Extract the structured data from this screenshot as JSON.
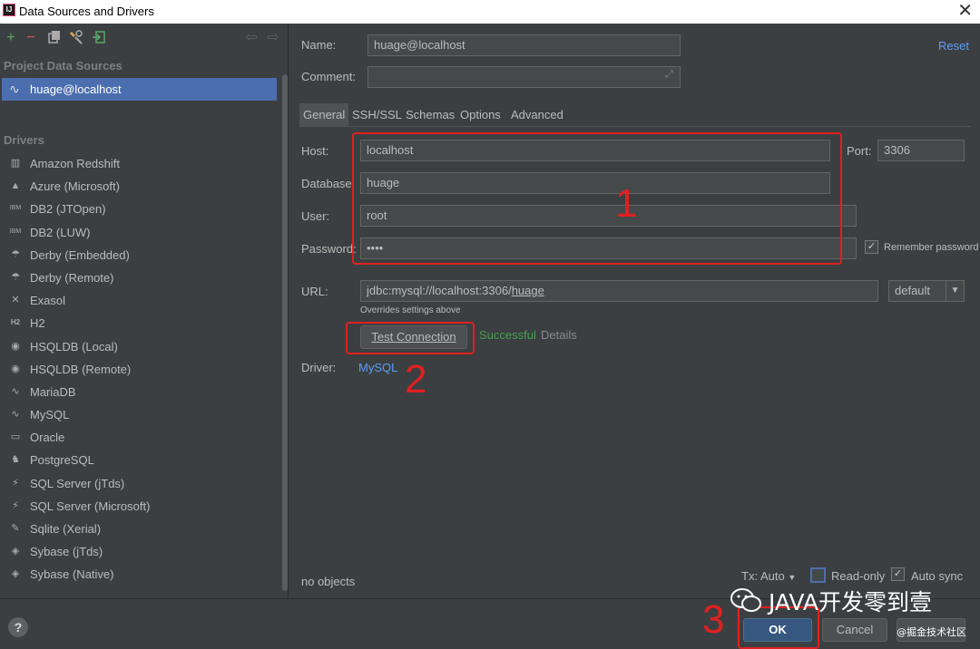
{
  "window": {
    "title": "Data Sources and Drivers",
    "app_icon": "IJ",
    "close_glyph": "✕"
  },
  "left": {
    "toolbar_icons": [
      "add-icon",
      "remove-icon",
      "copy-icon",
      "settings-icon",
      "import-icon",
      "back-icon",
      "forward-icon"
    ],
    "project_title": "Project Data Sources",
    "data_source": "huage@localhost",
    "drivers_title": "Drivers",
    "drivers": [
      {
        "label": "Amazon Redshift",
        "icon": "▥"
      },
      {
        "label": "Azure (Microsoft)",
        "icon": "▲"
      },
      {
        "label": "DB2 (JTOpen)",
        "icon": "IBM"
      },
      {
        "label": "DB2 (LUW)",
        "icon": "IBM"
      },
      {
        "label": "Derby (Embedded)",
        "icon": "☂"
      },
      {
        "label": "Derby (Remote)",
        "icon": "☂"
      },
      {
        "label": "Exasol",
        "icon": "✕"
      },
      {
        "label": "H2",
        "icon": "H2"
      },
      {
        "label": "HSQLDB (Local)",
        "icon": "◉"
      },
      {
        "label": "HSQLDB (Remote)",
        "icon": "◉"
      },
      {
        "label": "MariaDB",
        "icon": "∿"
      },
      {
        "label": "MySQL",
        "icon": "∿"
      },
      {
        "label": "Oracle",
        "icon": "▭"
      },
      {
        "label": "PostgreSQL",
        "icon": "♞"
      },
      {
        "label": "SQL Server (jTds)",
        "icon": "⚡"
      },
      {
        "label": "SQL Server (Microsoft)",
        "icon": "⚡"
      },
      {
        "label": "Sqlite (Xerial)",
        "icon": "✎"
      },
      {
        "label": "Sybase (jTds)",
        "icon": "◈"
      },
      {
        "label": "Sybase (Native)",
        "icon": "◈"
      }
    ]
  },
  "form": {
    "name_label": "Name:",
    "name_value": "huage@localhost",
    "reset": "Reset",
    "comment_label": "Comment:",
    "comment_value": "",
    "tabs": [
      "General",
      "SSH/SSL",
      "Schemas",
      "Options",
      "Advanced"
    ],
    "host_label": "Host:",
    "host_value": "localhost",
    "port_label": "Port:",
    "port_value": "3306",
    "database_label": "Database:",
    "database_value": "huage",
    "user_label": "User:",
    "user_value": "root",
    "password_label": "Password:",
    "password_value": "••••",
    "remember_password": "Remember password",
    "remember_checked": "✓",
    "url_label": "URL:",
    "url_prefix": "jdbc:mysql://localhost:3306/",
    "url_db": "huage",
    "url_mode": "default",
    "overrides_note": "Overrides settings above",
    "test_connection": "Test Connection",
    "test_status": "Successful",
    "details": "Details",
    "driver_label": "Driver:",
    "driver_value": "MySQL",
    "no_objects": "no objects",
    "tx": "Tx: Auto",
    "read_only": "Read-only",
    "auto_sync": "Auto sync",
    "auto_sync_checked": "✓"
  },
  "annotations": {
    "box1": "1",
    "box2": "2",
    "box3": "3"
  },
  "buttons": {
    "help": "?",
    "ok": "OK",
    "cancel": "Cancel"
  },
  "watermark": {
    "text": "JAVA开发零到壹",
    "sub": "@掘金技术社区"
  },
  "colors": {
    "accent": "#4b6eaf",
    "link": "#589df6",
    "success": "#499c54",
    "annotation": "#e02020",
    "ok_button": "#365880"
  }
}
